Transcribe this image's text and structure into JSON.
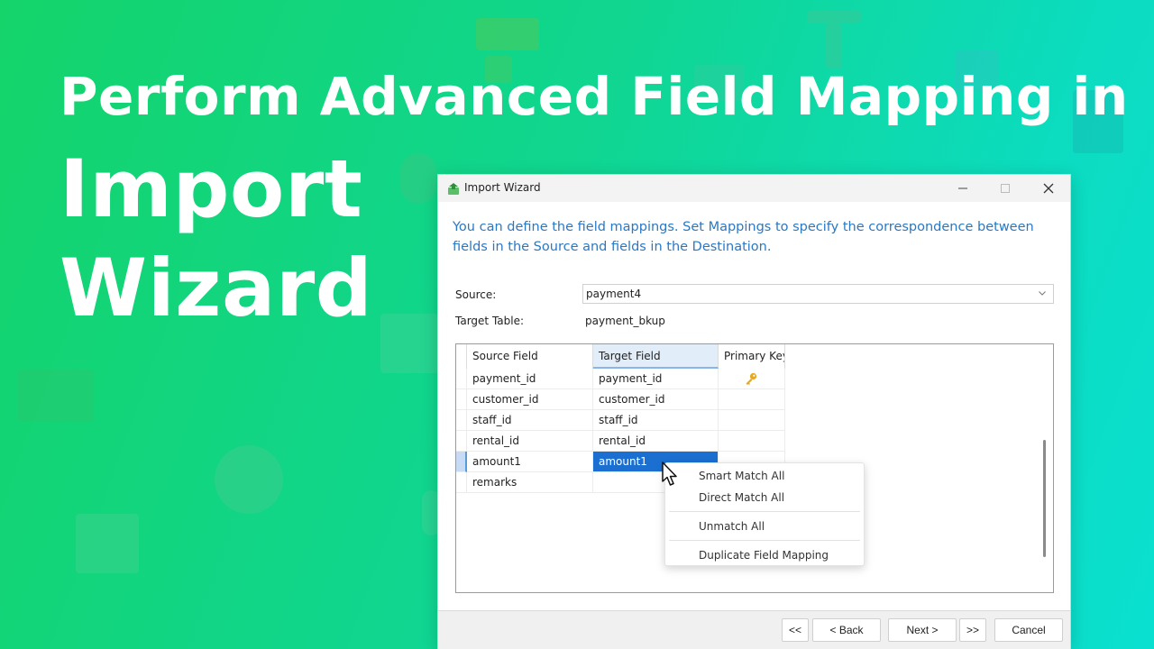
{
  "headline": {
    "line1": "Perform Advanced Field Mapping in",
    "line2": "Import",
    "line3": "Wizard"
  },
  "window": {
    "title": "Import Wizard",
    "description": "You can define the field mappings. Set Mappings to specify the correspondence between fields in the Source and fields in the Destination.",
    "source_label": "Source:",
    "source_value": "payment4",
    "target_label": "Target Table:",
    "target_value": "payment_bkup"
  },
  "grid": {
    "columns": [
      "Source Field",
      "Target Field",
      "Primary Key"
    ],
    "rows": [
      {
        "source": "payment_id",
        "target": "payment_id",
        "primary_key": true
      },
      {
        "source": "customer_id",
        "target": "customer_id",
        "primary_key": false
      },
      {
        "source": "staff_id",
        "target": "staff_id",
        "primary_key": false
      },
      {
        "source": "rental_id",
        "target": "rental_id",
        "primary_key": false
      },
      {
        "source": "amount1",
        "target": "amount1",
        "primary_key": false
      },
      {
        "source": "remarks",
        "target": "",
        "primary_key": false
      }
    ],
    "selected_row": 4
  },
  "context_menu": {
    "smart_match_all": "Smart Match All",
    "direct_match_all": "Direct Match All",
    "unmatch_all": "Unmatch All",
    "duplicate_field_mapping": "Duplicate Field Mapping"
  },
  "footer": {
    "first": "<<",
    "back": "< Back",
    "next": "Next >",
    "last": ">>",
    "cancel": "Cancel"
  },
  "colors": {
    "accent": "#2a78c4",
    "selection": "#1a6fd1",
    "key_icon": "#e5a823"
  },
  "icons": [
    "app-icon",
    "chevron-down-icon",
    "key-icon",
    "minimize-icon",
    "maximize-icon",
    "close-icon",
    "mouse-cursor-icon"
  ]
}
